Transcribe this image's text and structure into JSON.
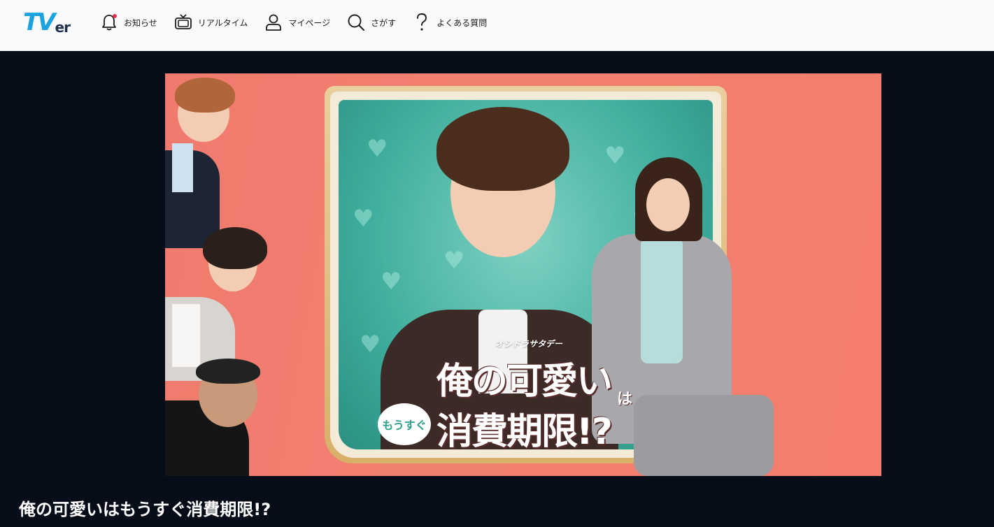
{
  "header": {
    "logo_tv": "TV",
    "logo_er": "er",
    "nav": [
      {
        "label": "お知らせ",
        "icon": "bell-icon",
        "has_notification": true
      },
      {
        "label": "リアルタイム",
        "icon": "tv-icon"
      },
      {
        "label": "マイページ",
        "icon": "user-icon"
      },
      {
        "label": "さがす",
        "icon": "search-icon"
      },
      {
        "label": "よくある質問",
        "icon": "question-icon"
      }
    ]
  },
  "hero": {
    "brand": "オシドラサタデー",
    "title_line1": "俺の可愛い",
    "title_ha": "は",
    "title_mousugu": "もうすぐ",
    "title_line2": "消費期限!?"
  },
  "program": {
    "title": "俺の可愛いはもうすぐ消費期限!?"
  },
  "colors": {
    "header_bg": "#f9fafc",
    "page_bg": "#060d18",
    "hero_bg": "#f28070",
    "logo_blue": "#1aa3e0",
    "notification_dot": "#e0334b",
    "teal": "#3fae9c"
  }
}
